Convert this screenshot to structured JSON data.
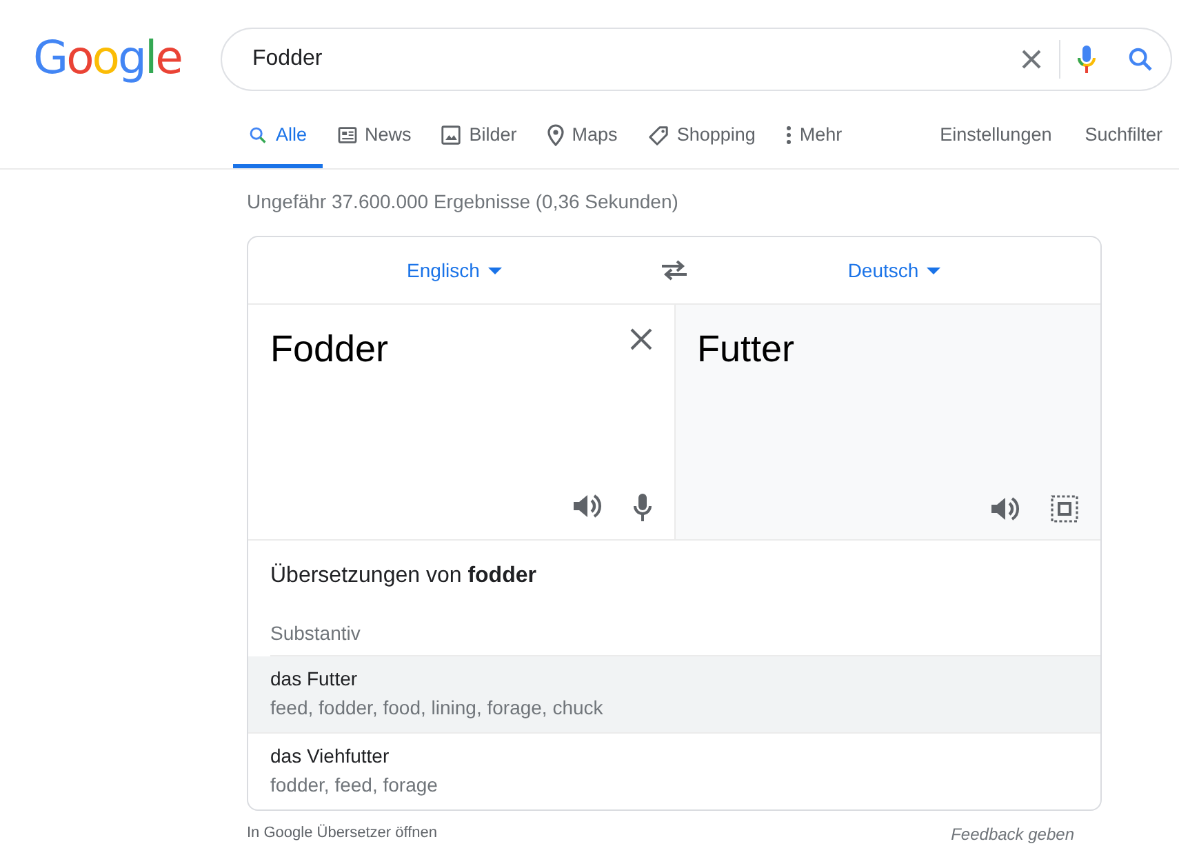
{
  "logo": "Google",
  "search": {
    "value": "Fodder"
  },
  "tabs": [
    {
      "label": "Alle",
      "kind": "search",
      "selected": true
    },
    {
      "label": "News",
      "kind": "news",
      "selected": false
    },
    {
      "label": "Bilder",
      "kind": "image",
      "selected": false
    },
    {
      "label": "Maps",
      "kind": "pin",
      "selected": false
    },
    {
      "label": "Shopping",
      "kind": "tag",
      "selected": false
    },
    {
      "label": "Mehr",
      "kind": "more",
      "selected": false
    }
  ],
  "tools": [
    "Einstellungen",
    "Suchfilter"
  ],
  "result_stats": "Ungefähr 37.600.000 Ergebnisse (0,36 Sekunden)",
  "translator": {
    "source_language": "Englisch",
    "target_language": "Deutsch",
    "source_text": "Fodder",
    "target_text": "Futter",
    "heading": "Übersetzungen von **fodder**",
    "part_of_speech": "Substantiv",
    "entries": [
      {
        "term": "das Futter",
        "synonyms": "feed, fodder, food, lining, forage, chuck",
        "highlighted": true
      },
      {
        "term": "das Viehfutter",
        "synonyms": "fodder, feed, forage",
        "highlighted": false
      }
    ]
  },
  "footer": {
    "open_link": "In Google Übersetzer öffnen",
    "feedback": "Feedback geben"
  }
}
